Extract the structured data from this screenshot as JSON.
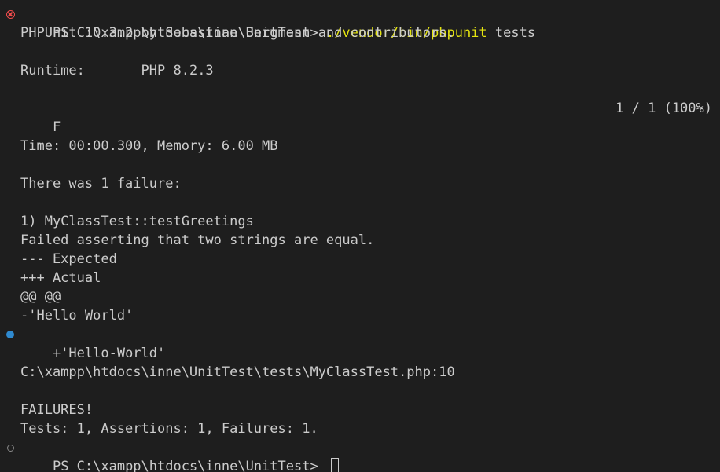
{
  "terminal": {
    "prompt_line": {
      "prompt": "PS C:\\xampp\\htdocs\\inne\\UnitTest> ",
      "command": "./vendor/bin/phpunit",
      "args": " tests"
    },
    "version_line": "PHPUnit 10.3.2 by Sebastian Bergmann and contributors.",
    "runtime_label": "Runtime:",
    "runtime_value": "PHP 8.2.3",
    "progress_result": "F",
    "progress_count": "1 / 1 (100%)",
    "time_memory": "Time: 00:00.300, Memory: 6.00 MB",
    "failure_heading": "There was 1 failure:",
    "failure_title": "1) MyClassTest::testGreetings",
    "failure_message": "Failed asserting that two strings are equal.",
    "diff_expected": "--- Expected",
    "diff_actual": "+++ Actual",
    "diff_hunk": "@@ @@",
    "diff_minus": "-'Hello World'",
    "diff_plus": "+'Hello-World'",
    "failure_location": "C:\\xampp\\htdocs\\inne\\UnitTest\\tests\\MyClassTest.php:10",
    "failures_banner": "FAILURES!",
    "summary": "Tests: 1, Assertions: 1, Failures: 1.",
    "final_prompt": "PS C:\\xampp\\htdocs\\inne\\UnitTest> "
  },
  "colors": {
    "background": "#1e1e1e",
    "text": "#cccccc",
    "command": "#e5e510",
    "error_icon": "#f14c4c",
    "marker_dot": "#2f8ad0"
  },
  "icons": {
    "first_command_status": "error-circle-icon",
    "diff_marker": "blue-dot-icon",
    "current_command_status": "idle-circle-icon"
  }
}
